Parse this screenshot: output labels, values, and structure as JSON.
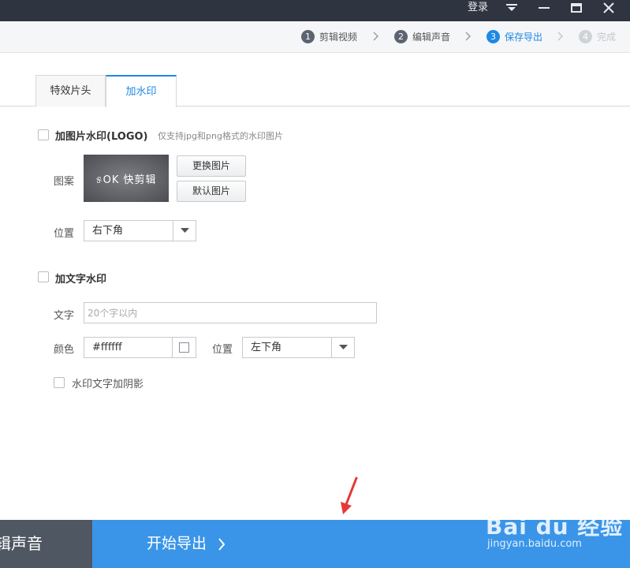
{
  "titlebar": {
    "login": "登录"
  },
  "steps": [
    {
      "num": "1",
      "label": "剪辑视频"
    },
    {
      "num": "2",
      "label": "编辑声音"
    },
    {
      "num": "3",
      "label": "保存导出"
    },
    {
      "num": "4",
      "label": "完成"
    }
  ],
  "tabs": [
    {
      "label": "特效片头"
    },
    {
      "label": "加水印"
    }
  ],
  "logo_watermark": {
    "title": "加图片水印(LOGO)",
    "hint": "仅支持jpg和png格式的水印图片",
    "pattern_label": "图案",
    "preview_text": "୫OK 快剪辑",
    "change_button": "更换图片",
    "default_button": "默认图片",
    "position_label": "位置",
    "position_value": "右下角"
  },
  "text_watermark": {
    "title": "加文字水印",
    "text_label": "文字",
    "text_placeholder": "20个字以内",
    "color_label": "颜色",
    "color_value": "#ffffff",
    "position_label": "位置",
    "position_value": "左下角",
    "shadow_label": "水印文字加阴影"
  },
  "bottom": {
    "left_label": "辑声音",
    "export_label": "开始导出"
  },
  "watermark_overlay": {
    "main": "Bai du 经验",
    "sub": "jingyan.baidu.com"
  },
  "colors": {
    "accent": "#1e88e5",
    "export_bar": "#3a95e8",
    "annotation": "#e53935"
  }
}
